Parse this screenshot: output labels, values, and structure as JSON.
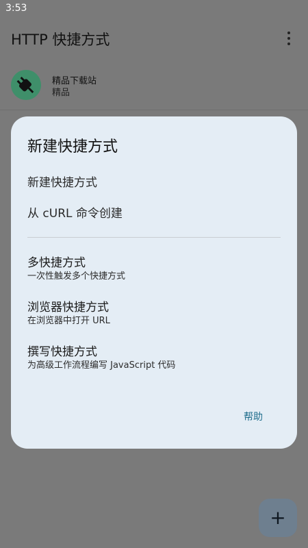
{
  "status_bar": {
    "time": "3:53"
  },
  "app_bar": {
    "title": "HTTP 快捷方式",
    "menu_icon": "more-vert-icon"
  },
  "list": {
    "items": [
      {
        "icon": "plug-icon",
        "title": "精品下载站",
        "subtitle": "精品"
      }
    ]
  },
  "dialog": {
    "title": "新建快捷方式",
    "primary_options": [
      {
        "label": "新建快捷方式"
      },
      {
        "label": "从 cURL 命令创建"
      }
    ],
    "secondary_options": [
      {
        "title": "多快捷方式",
        "subtitle": "一次性触发多个快捷方式"
      },
      {
        "title": "浏览器快捷方式",
        "subtitle": "在浏览器中打开 URL"
      },
      {
        "title": "撰写快捷方式",
        "subtitle": "为高级工作流程编写 JavaScript 代码"
      }
    ],
    "help_label": "帮助"
  },
  "fab": {
    "icon": "add-icon",
    "symbol": "+"
  },
  "colors": {
    "scrim": "#7a7a7a",
    "dialog_bg": "#e4edf5",
    "accent": "#1f6d8c",
    "avatar_bg": "#3f8f6a",
    "fab_bg": "#6e7f8f"
  }
}
